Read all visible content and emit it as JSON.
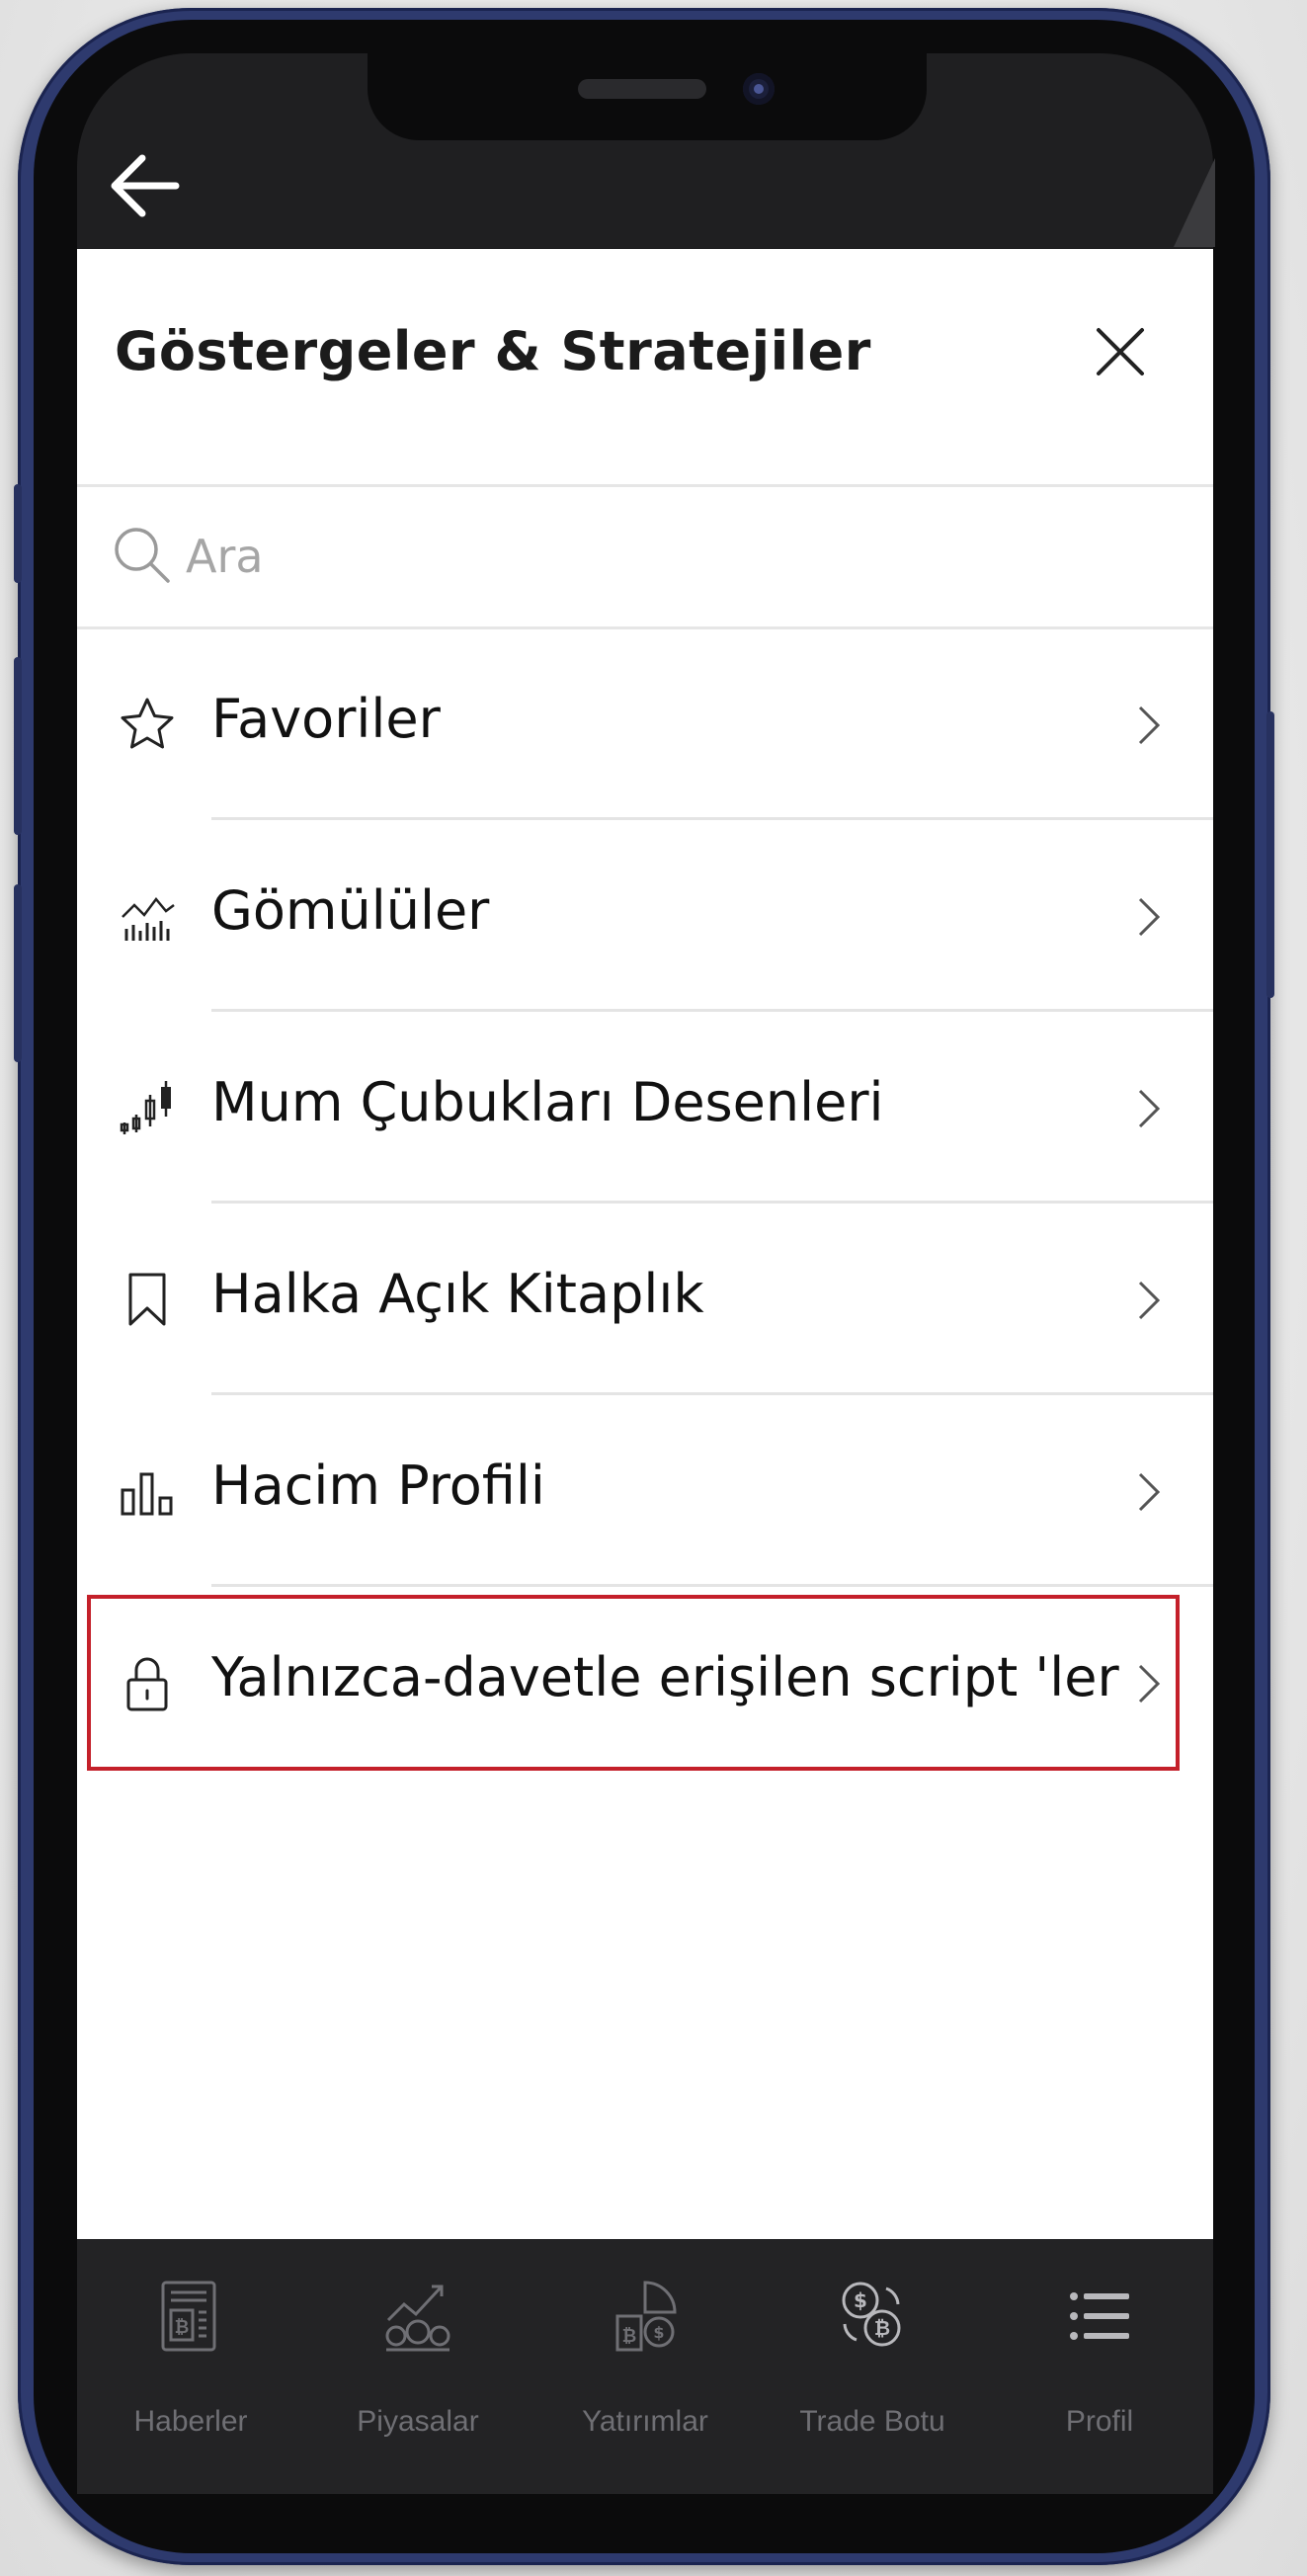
{
  "header": {
    "title": "Göstergeler & Stratejiler"
  },
  "search": {
    "placeholder": "Ara",
    "value": ""
  },
  "menu": {
    "items": [
      {
        "label": "Favoriler",
        "icon": "star-icon"
      },
      {
        "label": "Gömülüler",
        "icon": "builtin-chart-icon"
      },
      {
        "label": "Mum Çubukları Desenleri",
        "icon": "candlestick-icon"
      },
      {
        "label": "Halka Açık Kitaplık",
        "icon": "bookmark-icon"
      },
      {
        "label": "Hacim Profili",
        "icon": "volume-profile-icon"
      },
      {
        "label": "Yalnızca-davetle erişilen script 'ler",
        "icon": "lock-icon",
        "highlighted": true
      }
    ]
  },
  "tabbar": {
    "tabs": [
      {
        "label": "Haberler",
        "icon": "newspaper-icon"
      },
      {
        "label": "Piyasalar",
        "icon": "markets-icon"
      },
      {
        "label": "Yatırımlar",
        "icon": "investments-icon"
      },
      {
        "label": "Trade Botu",
        "icon": "trade-bot-icon"
      },
      {
        "label": "Profil",
        "icon": "menu-list-icon"
      }
    ]
  },
  "colors": {
    "phone_frame": "#2e3a6e",
    "highlight_border": "#c4202a",
    "tabbar_bg": "#232325",
    "tab_label": "#6f6f74"
  }
}
